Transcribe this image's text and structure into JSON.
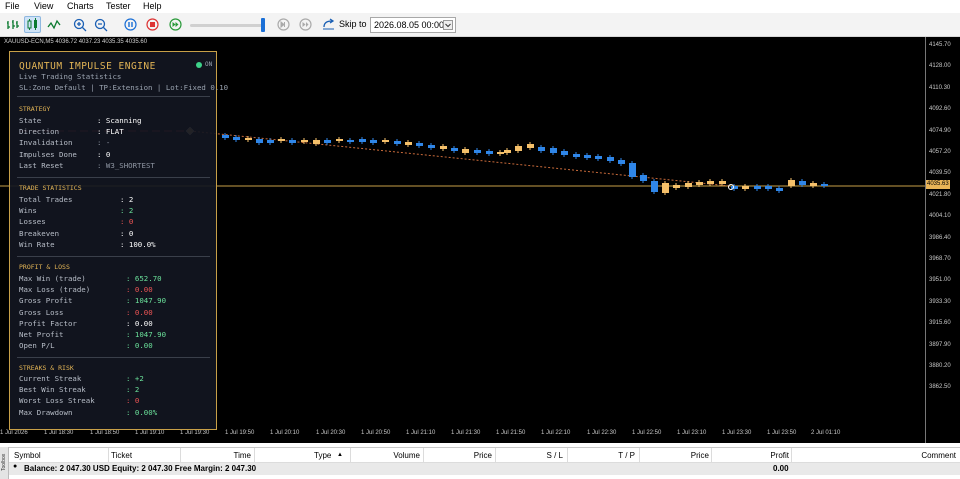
{
  "menu": [
    "File",
    "View",
    "Charts",
    "Tester",
    "Help"
  ],
  "toolbar": {
    "skip_label": "Skip to",
    "skip_date": "2026.08.05 00:00"
  },
  "chart": {
    "symbol_info": "XAUUSD-ECN,M5  4036.72 4037.23 4035.35 4035.60",
    "current_price": "4035.63",
    "y_ticks": [
      "4145.70",
      "4128.00",
      "4110.30",
      "4092.60",
      "4074.90",
      "4057.20",
      "4039.50",
      "4021.80",
      "4004.10",
      "3986.40",
      "3968.70",
      "3951.00",
      "3933.30",
      "3915.60",
      "3897.90",
      "3880.20",
      "3862.50"
    ],
    "x_ticks": [
      "1 Jul 2026",
      "1 Jul 18:30",
      "1 Jul 18:50",
      "1 Jul 19:10",
      "1 Jul 19:30",
      "1 Jul 19:50",
      "1 Jul 20:10",
      "1 Jul 20:30",
      "1 Jul 20:50",
      "1 Jul 21:10",
      "1 Jul 21:30",
      "1 Jul 21:50",
      "1 Jul 22:10",
      "1 Jul 22:30",
      "1 Jul 22:50",
      "1 Jul 23:10",
      "1 Jul 23:30",
      "1 Jul 23:50",
      "2 Jul 01:10"
    ],
    "colors": {
      "bull": "#f5c06a",
      "bear": "#2f86e8",
      "price_line": "#c8a048",
      "dashed_red": "#d84040"
    }
  },
  "panel": {
    "title": "QUANTUM IMPULSE ENGINE",
    "subtitle": "Live Trading Statistics",
    "params": "SL:Zone Default | TP:Extension | Lot:Fixed 0.10",
    "status_label": "ON",
    "sections": {
      "strategy": "STRATEGY",
      "trade_stats": "TRADE STATISTICS",
      "profit_loss": "PROFIT & LOSS",
      "streaks": "STREAKS & RISK"
    },
    "strategy": [
      {
        "label": "State",
        "value": ": Scanning"
      },
      {
        "label": "Direction",
        "value": ": FLAT"
      },
      {
        "label": "Invalidation",
        "value": ": -"
      },
      {
        "label": "Impulses Done",
        "value": ": 0"
      },
      {
        "label": "Last Reset",
        "value": ": W3_SHORTEST"
      }
    ],
    "trade_stats": [
      {
        "label": "Total Trades",
        "value": ": 2"
      },
      {
        "label": "Wins",
        "value": ": 2"
      },
      {
        "label": "Losses",
        "value": ": 0"
      },
      {
        "label": "Breakeven",
        "value": ": 0"
      },
      {
        "label": "Win Rate",
        "value": ": 100.0%"
      }
    ],
    "profit_loss": [
      {
        "label": "Max Win (trade)",
        "value": ": 652.70"
      },
      {
        "label": "Max Loss (trade)",
        "value": ": 0.00"
      },
      {
        "label": "Gross Profit",
        "value": ": 1047.90"
      },
      {
        "label": "Gross Loss",
        "value": ": 0.00"
      },
      {
        "label": "Profit Factor",
        "value": ": 0.00"
      },
      {
        "label": "Net Profit",
        "value": ": 1047.90"
      },
      {
        "label": "Open P/L",
        "value": ": 0.00"
      }
    ],
    "streaks": [
      {
        "label": "Current Streak",
        "value": ": +2"
      },
      {
        "label": "Best Win Streak",
        "value": ": 2"
      },
      {
        "label": "Worst Loss Streak",
        "value": ": 0"
      },
      {
        "label": "Max Drawdown",
        "value": ": 0.00%"
      }
    ]
  },
  "terminal": {
    "columns": [
      "Symbol",
      "Ticket",
      "Time",
      "Type",
      "Volume",
      "Price",
      "S / L",
      "T / P",
      "Price",
      "Profit",
      "Comment"
    ],
    "balance_text": "Balance: 2 047.30 USD  Equity: 2 047.30  Free Margin: 2 047.30",
    "profit_total": "0.00",
    "side_tab": "Toolbox"
  }
}
